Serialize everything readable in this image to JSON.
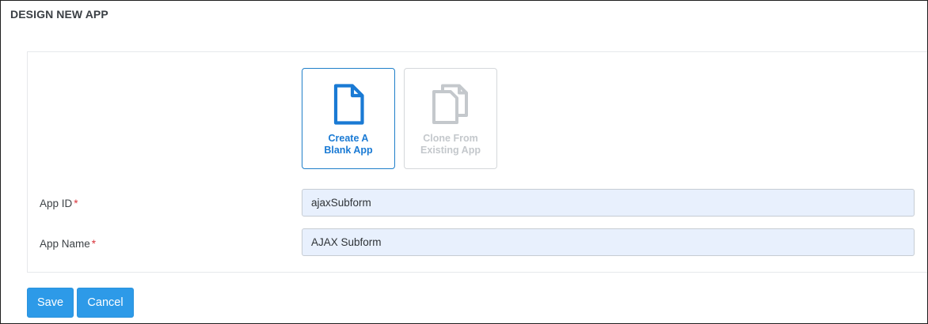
{
  "page": {
    "title": "DESIGN NEW APP"
  },
  "options": {
    "create_blank": {
      "label_line1": "Create A",
      "label_line2": "Blank App",
      "icon": "file-icon",
      "selected": true
    },
    "clone_existing": {
      "label_line1": "Clone From",
      "label_line2": "Existing App",
      "icon": "copy-icon",
      "disabled": true
    }
  },
  "form": {
    "app_id": {
      "label": "App ID",
      "required_mark": "*",
      "value": "ajaxSubform"
    },
    "app_name": {
      "label": "App Name",
      "required_mark": "*",
      "value": "AJAX Subform"
    }
  },
  "actions": {
    "save_label": "Save",
    "cancel_label": "Cancel"
  },
  "colors": {
    "accent": "#1a7ad4",
    "button": "#2d9ae8",
    "input_bg": "#e8f0fd",
    "required": "#d9343a",
    "disabled": "#c4c8cc"
  }
}
